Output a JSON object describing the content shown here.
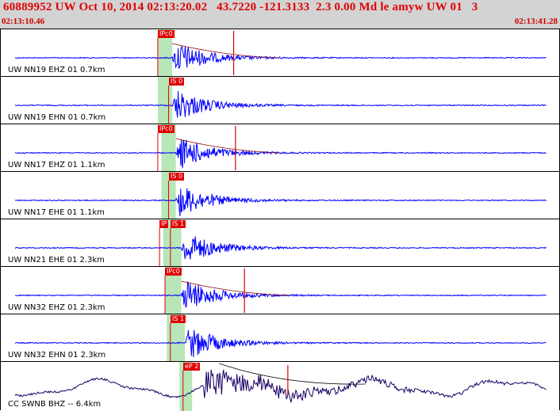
{
  "header": {
    "title": "60889952 UW Oct 10, 2014 02:13:20.02   43.7220 -121.3133  2.3 0.00 Md le amyw UW 01   3",
    "time_start": "02:13:10.46",
    "time_end": "02:13:41.28"
  },
  "chart_data": {
    "type": "waveform",
    "time_range": [
      "02:13:10.46",
      "02:13:41.28"
    ],
    "duration_s": 30.82,
    "colors": {
      "trace": "#0000ff",
      "long_period_trace": "#1a0066",
      "pick": "#e00000",
      "window": "#b8e6b8",
      "header_bg": "#d3d3d3",
      "header_text": "#e00000"
    },
    "traces": [
      {
        "label": "UW NN19 EHZ 01 0.7km",
        "picks": [
          {
            "label": "IPc0",
            "t": 8.6
          }
        ],
        "window": [
          8.6,
          9.4
        ],
        "arrival": 9.4,
        "marker": 12.8
      },
      {
        "label": "UW NN19 EHN 01 0.7km",
        "picks": [
          {
            "label": "IS 0",
            "t": 9.2
          }
        ],
        "window": [
          8.6,
          9.4
        ],
        "arrival": 9.4,
        "marker": null
      },
      {
        "label": "UW NN17 EHZ 01 1.1km",
        "picks": [
          {
            "label": "IPc0",
            "t": 8.6
          }
        ],
        "window": [
          8.8,
          9.6
        ],
        "arrival": 9.6,
        "marker": 12.9
      },
      {
        "label": "UW NN17 EHE 01 1.1km",
        "picks": [
          {
            "label": "IS 0",
            "t": 9.2
          }
        ],
        "window": [
          8.8,
          9.6
        ],
        "arrival": 9.6,
        "marker": null
      },
      {
        "label": "UW NN21 EHE 01 2.3km",
        "picks": [
          {
            "label": "IP",
            "t": 8.7
          },
          {
            "label": "IS 1",
            "t": 9.3
          }
        ],
        "window": [
          8.9,
          9.9
        ],
        "arrival": 9.9,
        "marker": null
      },
      {
        "label": "UW NN32 EHZ 01 2.3km",
        "picks": [
          {
            "label": "IPc0",
            "t": 9.0
          }
        ],
        "window": [
          9.0,
          9.9
        ],
        "arrival": 9.9,
        "marker": 13.4
      },
      {
        "label": "UW NN32 EHN 01 2.3km",
        "picks": [
          {
            "label": "IS 1",
            "t": 9.3
          }
        ],
        "window": [
          9.1,
          10.1
        ],
        "arrival": 10.1,
        "marker": null
      },
      {
        "label": "CC SWNB BHZ -- 6.4km",
        "picks": [
          {
            "label": "eP 2",
            "t": 10.0
          }
        ],
        "window": [
          9.8,
          10.5
        ],
        "arrival": 11.1,
        "marker": 15.8
      }
    ]
  }
}
